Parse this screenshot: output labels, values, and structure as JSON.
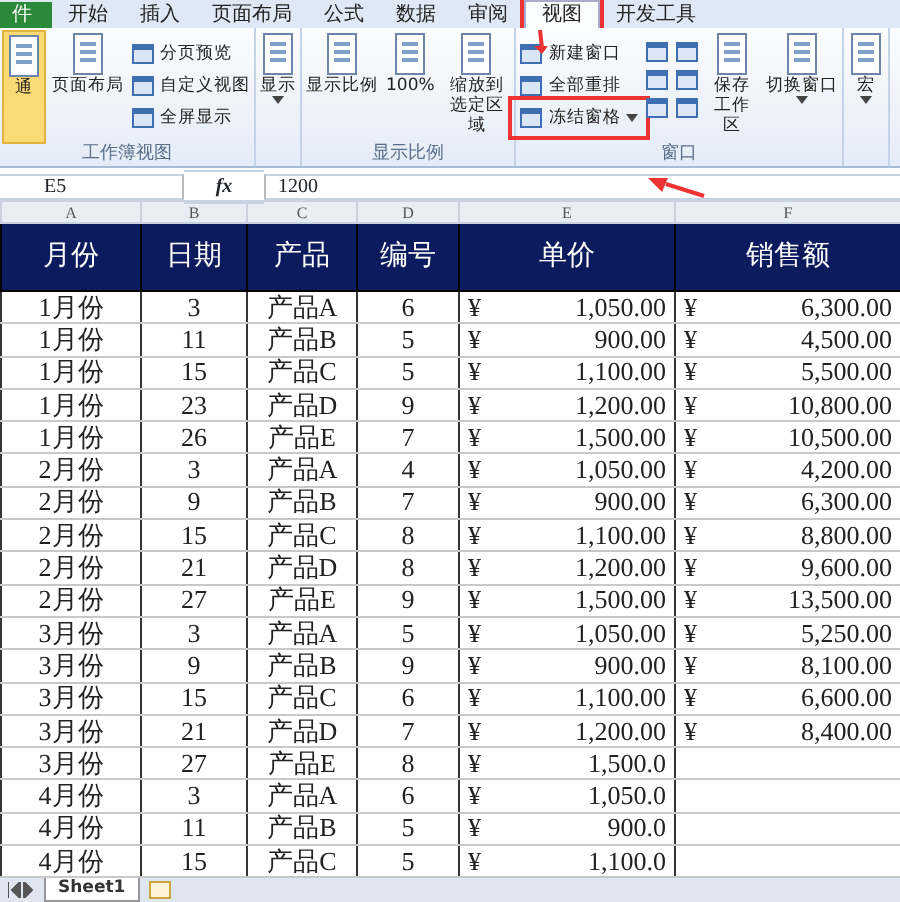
{
  "ribbon_tabs": [
    {
      "label": "件",
      "selected": false,
      "kind": "file"
    },
    {
      "label": "开始",
      "selected": false,
      "kind": "tab"
    },
    {
      "label": "插入",
      "selected": false,
      "kind": "tab"
    },
    {
      "label": "页面布局",
      "selected": false,
      "kind": "tab"
    },
    {
      "label": "公式",
      "selected": false,
      "kind": "tab"
    },
    {
      "label": "数据",
      "selected": false,
      "kind": "tab"
    },
    {
      "label": "审阅",
      "selected": false,
      "kind": "tab"
    },
    {
      "label": "视图",
      "selected": true,
      "kind": "tab"
    },
    {
      "label": "开发工具",
      "selected": false,
      "kind": "tab"
    }
  ],
  "ribbon_groups": [
    {
      "label": "工作簿视图",
      "items": [
        {
          "kind": "big",
          "label": "通",
          "active": true,
          "dropdown": false
        },
        {
          "kind": "big",
          "label": "页面布局",
          "active": false,
          "dropdown": false
        },
        {
          "kind": "small",
          "label": "分页预览",
          "dropdown": false
        },
        {
          "kind": "small",
          "label": "自定义视图",
          "dropdown": false
        },
        {
          "kind": "small",
          "label": "全屏显示",
          "dropdown": false
        }
      ]
    },
    {
      "items": [
        {
          "kind": "big",
          "label": "显示",
          "active": false,
          "dropdown": true
        }
      ]
    },
    {
      "label": "显示比例",
      "items": [
        {
          "kind": "big",
          "label": "显示比例",
          "active": false,
          "dropdown": false
        },
        {
          "kind": "big",
          "label": "100%",
          "active": false,
          "dropdown": false
        },
        {
          "kind": "big",
          "label": "缩放到选定区域",
          "active": false,
          "dropdown": false
        }
      ]
    },
    {
      "label": "窗口",
      "items": [
        {
          "kind": "small",
          "label": "新建窗口",
          "dropdown": false
        },
        {
          "kind": "small",
          "label": "全部重排",
          "dropdown": false
        },
        {
          "kind": "small",
          "label": "冻结窗格",
          "dropdown": true
        },
        {
          "kind": "icons"
        },
        {
          "kind": "icons"
        },
        {
          "kind": "big",
          "label": "保存工作区",
          "active": false,
          "dropdown": false
        },
        {
          "kind": "big",
          "label": "切换窗口",
          "active": false,
          "dropdown": true
        }
      ]
    },
    {
      "items": [
        {
          "kind": "big",
          "label": "宏",
          "active": false,
          "dropdown": true
        }
      ]
    }
  ],
  "formula_bar": {
    "name_box": "E5",
    "fx": "fx",
    "value": "1200"
  },
  "column_letters": [
    "A",
    "B",
    "C",
    "D",
    "E",
    "F"
  ],
  "table": {
    "columns": [
      "月份",
      "日期",
      "产品",
      "编号",
      "单价",
      "销售额"
    ],
    "rows": [
      {
        "month": "1月份",
        "day": "3",
        "product": "产品A",
        "number": "6",
        "price_currency": "¥",
        "price": "1,050.00",
        "sales_currency": "¥",
        "sales": "6,300.00"
      },
      {
        "month": "1月份",
        "day": "11",
        "product": "产品B",
        "number": "5",
        "price_currency": "¥",
        "price": "900.00",
        "sales_currency": "¥",
        "sales": "4,500.00"
      },
      {
        "month": "1月份",
        "day": "15",
        "product": "产品C",
        "number": "5",
        "price_currency": "¥",
        "price": "1,100.00",
        "sales_currency": "¥",
        "sales": "5,500.00"
      },
      {
        "month": "1月份",
        "day": "23",
        "product": "产品D",
        "number": "9",
        "price_currency": "¥",
        "price": "1,200.00",
        "sales_currency": "¥",
        "sales": "10,800.00"
      },
      {
        "month": "1月份",
        "day": "26",
        "product": "产品E",
        "number": "7",
        "price_currency": "¥",
        "price": "1,500.00",
        "sales_currency": "¥",
        "sales": "10,500.00"
      },
      {
        "month": "2月份",
        "day": "3",
        "product": "产品A",
        "number": "4",
        "price_currency": "¥",
        "price": "1,050.00",
        "sales_currency": "¥",
        "sales": "4,200.00"
      },
      {
        "month": "2月份",
        "day": "9",
        "product": "产品B",
        "number": "7",
        "price_currency": "¥",
        "price": "900.00",
        "sales_currency": "¥",
        "sales": "6,300.00"
      },
      {
        "month": "2月份",
        "day": "15",
        "product": "产品C",
        "number": "8",
        "price_currency": "¥",
        "price": "1,100.00",
        "sales_currency": "¥",
        "sales": "8,800.00"
      },
      {
        "month": "2月份",
        "day": "21",
        "product": "产品D",
        "number": "8",
        "price_currency": "¥",
        "price": "1,200.00",
        "sales_currency": "¥",
        "sales": "9,600.00"
      },
      {
        "month": "2月份",
        "day": "27",
        "product": "产品E",
        "number": "9",
        "price_currency": "¥",
        "price": "1,500.00",
        "sales_currency": "¥",
        "sales": "13,500.00"
      },
      {
        "month": "3月份",
        "day": "3",
        "product": "产品A",
        "number": "5",
        "price_currency": "¥",
        "price": "1,050.00",
        "sales_currency": "¥",
        "sales": "5,250.00"
      },
      {
        "month": "3月份",
        "day": "9",
        "product": "产品B",
        "number": "9",
        "price_currency": "¥",
        "price": "900.00",
        "sales_currency": "¥",
        "sales": "8,100.00"
      },
      {
        "month": "3月份",
        "day": "15",
        "product": "产品C",
        "number": "6",
        "price_currency": "¥",
        "price": "1,100.00",
        "sales_currency": "¥",
        "sales": "6,600.00"
      },
      {
        "month": "3月份",
        "day": "21",
        "product": "产品D",
        "number": "7",
        "price_currency": "¥",
        "price": "1,200.00",
        "sales_currency": "¥",
        "sales": "8,400.00"
      },
      {
        "month": "3月份",
        "day": "27",
        "product": "产品E",
        "number": "8",
        "price_currency": "¥",
        "price": "1,500.0"
      },
      {
        "month": "4月份",
        "day": "3",
        "product": "产品A",
        "number": "6",
        "price_currency": "¥",
        "price": "1,050.0"
      },
      {
        "month": "4月份",
        "day": "11",
        "product": "产品B",
        "number": "5",
        "price_currency": "¥",
        "price": "900.0"
      },
      {
        "month": "4月份",
        "day": "15",
        "product": "产品C",
        "number": "5",
        "price_currency": "¥",
        "price": "1,100.0"
      }
    ]
  },
  "sheet_tabs": [
    {
      "label": "Sheet1",
      "selected": true
    }
  ]
}
